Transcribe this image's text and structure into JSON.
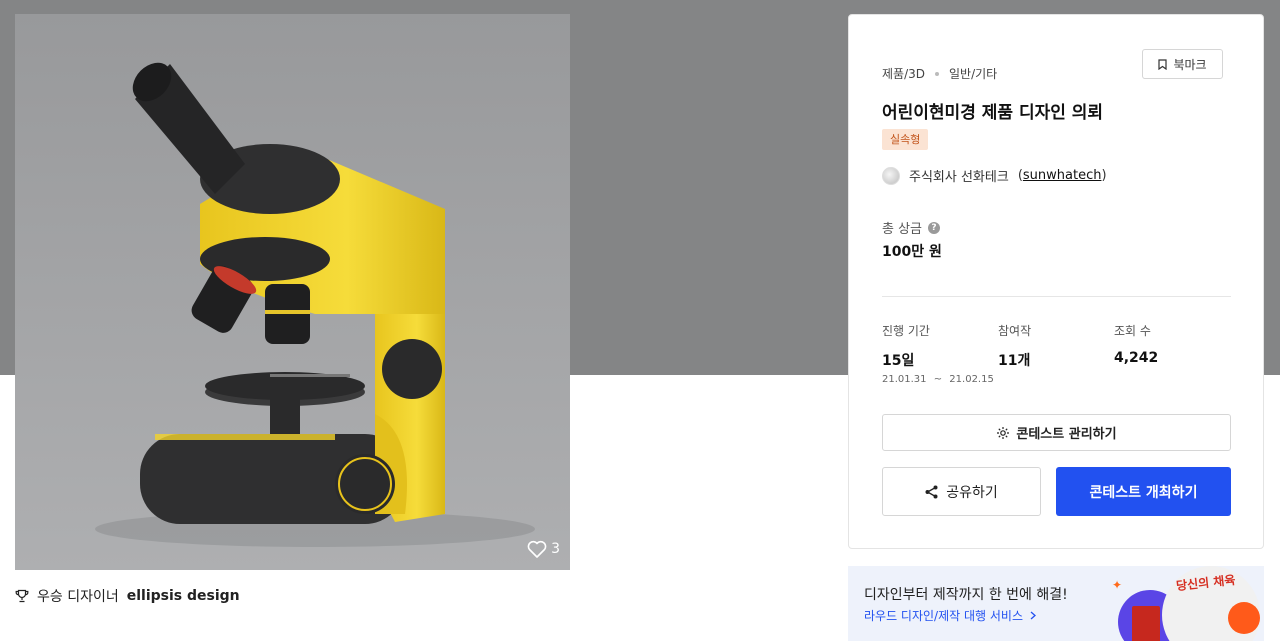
{
  "gallery": {
    "likes": "3",
    "winner_prefix": "우승 디자이너",
    "winner_name": "ellipsis design"
  },
  "contest": {
    "category": "제품/3D",
    "subcategory": "일반/기타",
    "bookmark_label": "북마크",
    "title": "어린이현미경 제품 디자인 의뢰",
    "tag": "실속형",
    "host_name": "주식회사 선화테크",
    "host_id": "sunwhatech",
    "prize_label": "총 상금",
    "prize_value": "100만 원",
    "stats": {
      "period_label": "진행 기간",
      "period_value": "15일",
      "period_start": "21.01.31",
      "period_sep": "~",
      "period_end": "21.02.15",
      "entries_label": "참여작",
      "entries_value": "11개",
      "views_label": "조회 수",
      "views_value": "4,242"
    },
    "manage_label": "콘테스트 관리하기",
    "share_label": "공유하기",
    "host_contest_label": "콘테스트 개최하기"
  },
  "ad": {
    "title": "디자인부터 제작까지 한 번에 해결!",
    "link": "라우드 디자인/제작 대행 서비스",
    "image_text": "당신의 채육"
  },
  "colors": {
    "hero": "#848586",
    "primary": "#2251f0",
    "tag_bg": "#fbe3d3",
    "tag_text": "#c2541b",
    "microscope_yellow": "#f2d32c",
    "microscope_dark": "#2f2f30"
  },
  "icons": {
    "heart": "heart-icon",
    "trophy": "trophy-icon",
    "bookmark": "bookmark-icon",
    "help": "question-icon",
    "gear": "gear-icon",
    "share": "share-icon",
    "chevron": "chevron-right-icon"
  }
}
